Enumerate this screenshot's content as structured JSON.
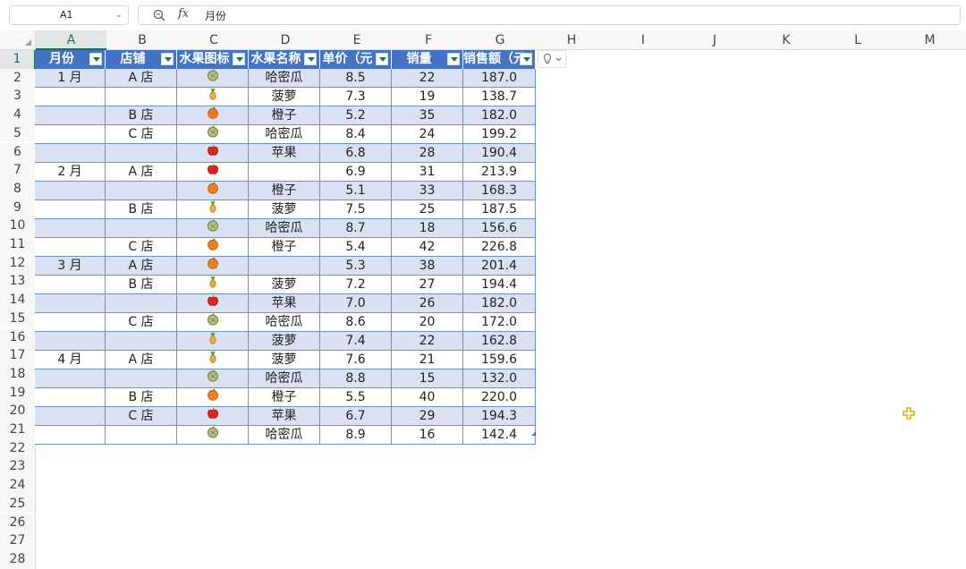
{
  "name_box": {
    "ref": "A1"
  },
  "formula_bar": {
    "value": "月份",
    "fx_label": "fx"
  },
  "columns": [
    "A",
    "B",
    "C",
    "D",
    "E",
    "F",
    "G",
    "H",
    "I",
    "J",
    "K",
    "L",
    "M"
  ],
  "rows": [
    "1",
    "2",
    "3",
    "4",
    "5",
    "6",
    "7",
    "8",
    "9",
    "10",
    "11",
    "12",
    "13",
    "14",
    "15",
    "16",
    "17",
    "18",
    "19",
    "20",
    "21",
    "22",
    "23",
    "24",
    "25",
    "26",
    "27",
    "28"
  ],
  "table": {
    "headers": [
      "月份",
      "店铺",
      "水果图标",
      "水果名称",
      "单价（元",
      "销量",
      "销售额（元"
    ],
    "rows": [
      {
        "month": "1 月",
        "shop": "A 店",
        "icon": "melon",
        "fruit": "哈密瓜",
        "price": "8.5",
        "qty": "22",
        "sales": "187.0"
      },
      {
        "month": "",
        "shop": "",
        "icon": "pineapple",
        "fruit": "菠萝",
        "price": "7.3",
        "qty": "19",
        "sales": "138.7"
      },
      {
        "month": "",
        "shop": "B 店",
        "icon": "orange",
        "fruit": "橙子",
        "price": "5.2",
        "qty": "35",
        "sales": "182.0"
      },
      {
        "month": "",
        "shop": "C 店",
        "icon": "melon",
        "fruit": "哈密瓜",
        "price": "8.4",
        "qty": "24",
        "sales": "199.2"
      },
      {
        "month": "",
        "shop": "",
        "icon": "apple",
        "fruit": "苹果",
        "price": "6.8",
        "qty": "28",
        "sales": "190.4"
      },
      {
        "month": "2 月",
        "shop": "A 店",
        "icon": "apple",
        "fruit": "",
        "price": "6.9",
        "qty": "31",
        "sales": "213.9"
      },
      {
        "month": "",
        "shop": "",
        "icon": "orange",
        "fruit": "橙子",
        "price": "5.1",
        "qty": "33",
        "sales": "168.3"
      },
      {
        "month": "",
        "shop": "B 店",
        "icon": "pineapple",
        "fruit": "菠萝",
        "price": "7.5",
        "qty": "25",
        "sales": "187.5"
      },
      {
        "month": "",
        "shop": "",
        "icon": "melon",
        "fruit": "哈密瓜",
        "price": "8.7",
        "qty": "18",
        "sales": "156.6"
      },
      {
        "month": "",
        "shop": "C 店",
        "icon": "orange",
        "fruit": "橙子",
        "price": "5.4",
        "qty": "42",
        "sales": "226.8"
      },
      {
        "month": "3 月",
        "shop": "A 店",
        "icon": "orange",
        "fruit": "",
        "price": "5.3",
        "qty": "38",
        "sales": "201.4"
      },
      {
        "month": "",
        "shop": "B 店",
        "icon": "pineapple",
        "fruit": "菠萝",
        "price": "7.2",
        "qty": "27",
        "sales": "194.4"
      },
      {
        "month": "",
        "shop": "",
        "icon": "apple",
        "fruit": "苹果",
        "price": "7.0",
        "qty": "26",
        "sales": "182.0"
      },
      {
        "month": "",
        "shop": "C 店",
        "icon": "melon",
        "fruit": "哈密瓜",
        "price": "8.6",
        "qty": "20",
        "sales": "172.0"
      },
      {
        "month": "",
        "shop": "",
        "icon": "pineapple",
        "fruit": "菠萝",
        "price": "7.4",
        "qty": "22",
        "sales": "162.8"
      },
      {
        "month": "4 月",
        "shop": "A 店",
        "icon": "pineapple",
        "fruit": "菠萝",
        "price": "7.6",
        "qty": "21",
        "sales": "159.6"
      },
      {
        "month": "",
        "shop": "",
        "icon": "melon",
        "fruit": "哈密瓜",
        "price": "8.8",
        "qty": "15",
        "sales": "132.0"
      },
      {
        "month": "",
        "shop": "B 店",
        "icon": "orange",
        "fruit": "橙子",
        "price": "5.5",
        "qty": "40",
        "sales": "220.0"
      },
      {
        "month": "",
        "shop": "C 店",
        "icon": "apple",
        "fruit": "苹果",
        "price": "6.7",
        "qty": "29",
        "sales": "194.3"
      },
      {
        "month": "",
        "shop": "",
        "icon": "melon",
        "fruit": "哈密瓜",
        "price": "8.9",
        "qty": "16",
        "sales": "142.4"
      }
    ]
  },
  "colors": {
    "header_bg": "#4472c4",
    "band_bg": "#d9e1f2",
    "selection": "#217346"
  }
}
